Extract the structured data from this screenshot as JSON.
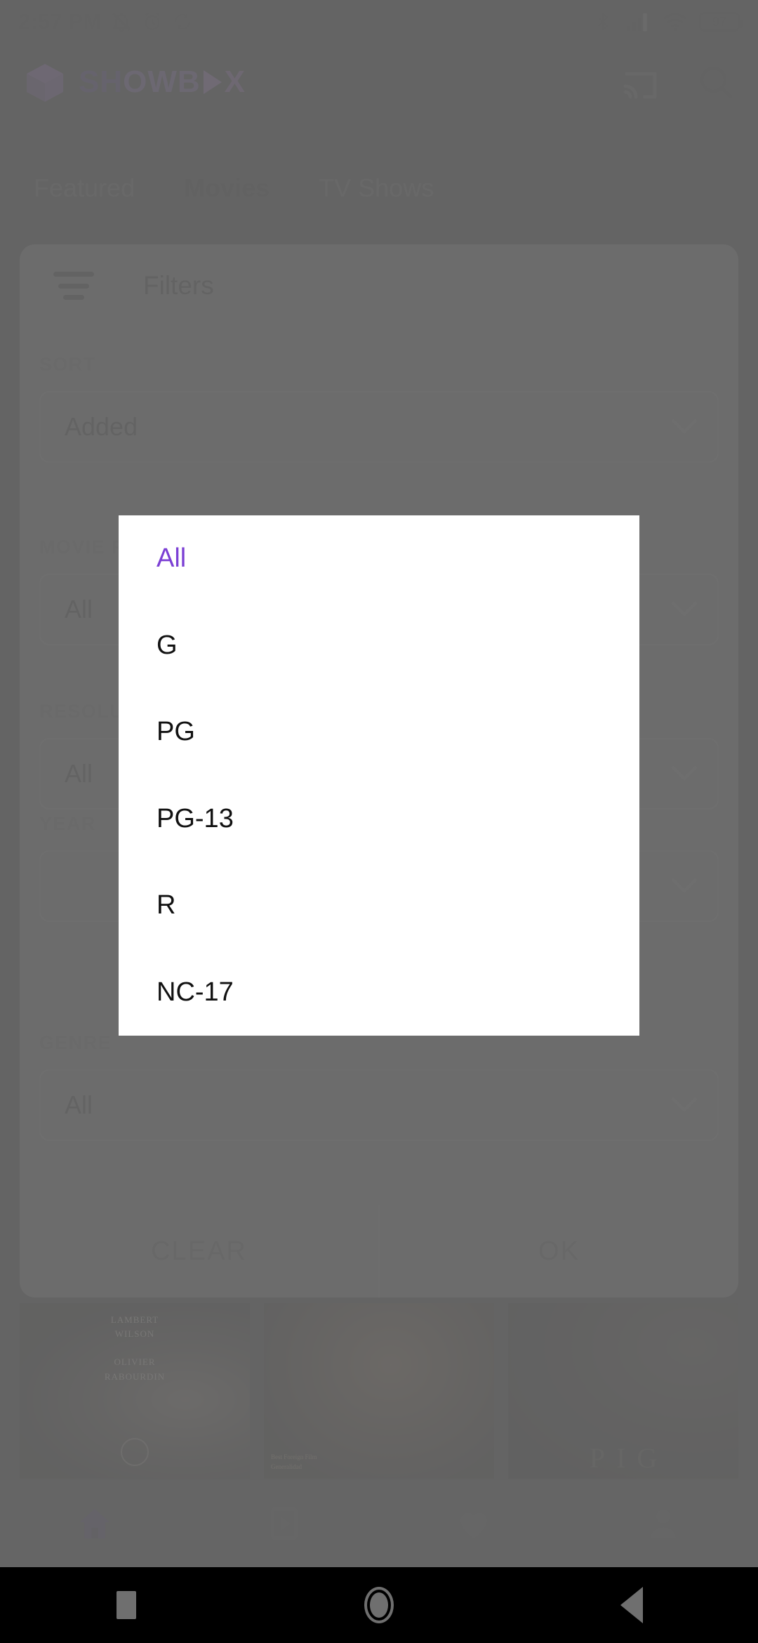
{
  "status_bar": {
    "time": "2:57 PM",
    "icons_left": [
      "silent-bell-icon",
      "alarm-icon",
      "sync-icon"
    ],
    "icons_right": [
      "bluetooth-icon",
      "cell-signal-icon",
      "wifi-icon"
    ],
    "battery_level": "97"
  },
  "app_header": {
    "logo_part1": "SH",
    "logo_part2": "OWB",
    "logo_part3": "X",
    "logo_full": "SHOWBOX",
    "cast_icon": "cast-icon",
    "search_icon": "search-icon"
  },
  "tabs": [
    {
      "label": "Featured",
      "active": false
    },
    {
      "label": "Movies",
      "active": true
    },
    {
      "label": "TV Shows",
      "active": false
    }
  ],
  "filters": {
    "title": "Filters",
    "icon": "filter-lines-icon",
    "fields": [
      {
        "label": "SORT",
        "value": "Added"
      },
      {
        "label": "MOVIE RATING",
        "value": "All"
      },
      {
        "label": "RESOLUTION",
        "value": "All"
      },
      {
        "label": "YEAR",
        "value": ""
      },
      {
        "label": "GENRE",
        "value": "All"
      }
    ],
    "clear_label": "CLEAR",
    "ok_label": "OK"
  },
  "rating_dialog": {
    "options": [
      {
        "label": "All",
        "selected": true
      },
      {
        "label": "G",
        "selected": false
      },
      {
        "label": "PG",
        "selected": false
      },
      {
        "label": "PG-13",
        "selected": false
      },
      {
        "label": "R",
        "selected": false
      },
      {
        "label": "NC-17",
        "selected": false
      }
    ],
    "accent_color": "#7b3fd4"
  },
  "posters": [
    {
      "credits": "LAMBERT\nWILSON\n\nOLIVIER\nRABOURDIN",
      "title": ""
    },
    {
      "award": "Best Foreign Film\nGeneralidad",
      "title": ""
    },
    {
      "title": "PIG"
    }
  ],
  "bottom_nav": [
    {
      "icon": "home-icon",
      "active": true
    },
    {
      "icon": "video-player-icon",
      "active": false
    },
    {
      "icon": "heart-icon",
      "active": false
    },
    {
      "icon": "person-icon",
      "active": false
    }
  ],
  "system_nav": [
    {
      "icon": "recents-square-icon"
    },
    {
      "icon": "home-circle-icon"
    },
    {
      "icon": "back-triangle-icon"
    }
  ]
}
